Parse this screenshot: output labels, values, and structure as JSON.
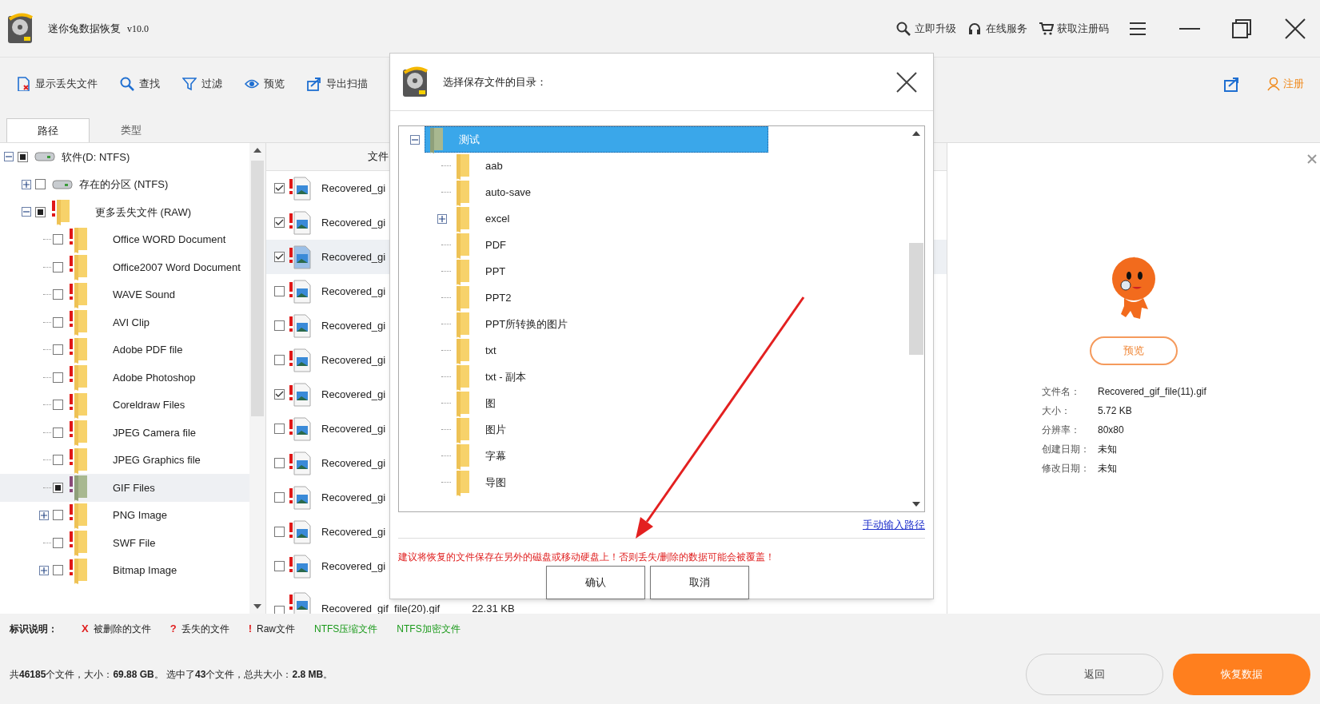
{
  "window": {
    "title": "迷你兔数据恢复",
    "version": "v10.0"
  },
  "header_links": [
    {
      "kind": "upgrade",
      "label": "立即升级"
    },
    {
      "kind": "service",
      "label": "在线服务"
    },
    {
      "kind": "cart",
      "label": "获取注册码"
    }
  ],
  "toolbar": {
    "items": [
      {
        "kind": "show-lost",
        "label": "显示丢失文件"
      },
      {
        "kind": "find",
        "label": "查找"
      },
      {
        "kind": "filter",
        "label": "过滤"
      },
      {
        "kind": "preview",
        "label": "预览"
      },
      {
        "kind": "export",
        "label": "导出扫描"
      }
    ],
    "register": "注册"
  },
  "tabs": [
    {
      "label": "路径",
      "selected": true
    },
    {
      "label": "类型",
      "selected": false
    }
  ],
  "tree": [
    {
      "label": "软件(D: NTFS)",
      "kind": "drive",
      "expanded": true,
      "partial": true,
      "selected": false,
      "children": [
        {
          "label": "存在的分区 (NTFS)",
          "kind": "drive",
          "expanded": false,
          "partial": false,
          "selected": false
        },
        {
          "label": "更多丢失文件 (RAW)",
          "kind": "folder",
          "expanded": true,
          "partial": true,
          "selected": false,
          "children": [
            {
              "label": "Office WORD Document",
              "kind": "folder",
              "partial": false,
              "selected": false
            },
            {
              "label": "Office2007 Word Document",
              "kind": "folder",
              "partial": false,
              "selected": false
            },
            {
              "label": "WAVE Sound",
              "kind": "folder",
              "partial": false,
              "selected": false
            },
            {
              "label": "AVI Clip",
              "kind": "folder",
              "partial": false,
              "selected": false
            },
            {
              "label": "Adobe PDF file",
              "kind": "folder",
              "partial": false,
              "selected": false
            },
            {
              "label": "Adobe Photoshop",
              "kind": "folder",
              "partial": false,
              "selected": false
            },
            {
              "label": "Coreldraw Files",
              "kind": "folder",
              "partial": false,
              "selected": false
            },
            {
              "label": "JPEG Camera file",
              "kind": "folder",
              "partial": false,
              "selected": false
            },
            {
              "label": "JPEG Graphics file",
              "kind": "folder",
              "partial": false,
              "selected": false
            },
            {
              "label": "GIF Files",
              "kind": "folder",
              "partial": true,
              "selected": true
            },
            {
              "label": "PNG Image",
              "kind": "folder",
              "expanded": false,
              "partial": false,
              "selected": false
            },
            {
              "label": "SWF File",
              "kind": "folder",
              "partial": false,
              "selected": false
            },
            {
              "label": "Bitmap Image",
              "kind": "folder",
              "expanded": false,
              "partial": false,
              "selected": false
            }
          ]
        }
      ]
    }
  ],
  "list": {
    "columns": [
      "文件"
    ],
    "rows": [
      {
        "name": "Recovered_gi",
        "checked": true,
        "selected": false
      },
      {
        "name": "Recovered_gi",
        "checked": true,
        "selected": false
      },
      {
        "name": "Recovered_gi",
        "checked": true,
        "selected": true
      },
      {
        "name": "Recovered_gi",
        "checked": false,
        "selected": false
      },
      {
        "name": "Recovered_gi",
        "checked": false,
        "selected": false
      },
      {
        "name": "Recovered_gi",
        "checked": false,
        "selected": false
      },
      {
        "name": "Recovered_gi",
        "checked": true,
        "selected": false
      },
      {
        "name": "Recovered_gi",
        "checked": false,
        "selected": false
      },
      {
        "name": "Recovered_gi",
        "checked": false,
        "selected": false
      },
      {
        "name": "Recovered_gi",
        "checked": false,
        "selected": false
      },
      {
        "name": "Recovered_gi",
        "checked": false,
        "selected": false
      },
      {
        "name": "Recovered_gi",
        "checked": false,
        "selected": false
      },
      {
        "name": "Recovered_gif_file(20).gif",
        "size": "22.31 KB",
        "checked": false,
        "selected": false
      }
    ]
  },
  "dialog": {
    "title": "选择保存文件的目录：",
    "tree": [
      {
        "label": "测试",
        "selected": true,
        "expanded": true,
        "children": [
          {
            "label": "aab",
            "selected": false
          },
          {
            "label": "auto-save",
            "selected": false
          },
          {
            "label": "excel",
            "selected": false,
            "expanded": false
          },
          {
            "label": "PDF",
            "selected": false
          },
          {
            "label": "PPT",
            "selected": false
          },
          {
            "label": "PPT2",
            "selected": false
          },
          {
            "label": "PPT所转换的图片",
            "selected": false
          },
          {
            "label": "txt",
            "selected": false
          },
          {
            "label": "txt - 副本",
            "selected": false
          },
          {
            "label": "图",
            "selected": false
          },
          {
            "label": "图片",
            "selected": false
          },
          {
            "label": "字幕",
            "selected": false
          },
          {
            "label": "导图",
            "selected": false
          }
        ]
      }
    ],
    "manual_link": "手动输入路径",
    "warning": "建议将恢复的文件保存在另外的磁盘或移动硬盘上！否则丢失/删除的数据可能会被覆盖！",
    "buttons": [
      "确认",
      "取消"
    ]
  },
  "preview": {
    "button": "预览",
    "info": [
      {
        "label": "文件名：",
        "value": "Recovered_gif_file(11).gif"
      },
      {
        "label": "大小：",
        "value": "5.72 KB"
      },
      {
        "label": "分辨率：",
        "value": "80x80"
      },
      {
        "label": "创建日期：",
        "value": "未知"
      },
      {
        "label": "修改日期：",
        "value": "未知"
      }
    ]
  },
  "legend": {
    "title": "标识说明：",
    "items": [
      {
        "mark": "X",
        "label": "被删除的文件",
        "color": "#e02020"
      },
      {
        "mark": "?",
        "label": "丢失的文件",
        "color": "#e02020"
      },
      {
        "mark": "!",
        "label": "Raw文件",
        "color": "#e02020"
      },
      {
        "label": "NTFS压缩文件",
        "color": "#1a9a1a"
      },
      {
        "label": "NTFS加密文件",
        "color": "#1a9a1a"
      }
    ]
  },
  "footer": {
    "summary": "共**46185**个文件，大小：**69.88 GB**。 选中了**43**个文件，总共大小：**2.8 MB**。",
    "back": "返回",
    "recover": "恢复数据"
  }
}
